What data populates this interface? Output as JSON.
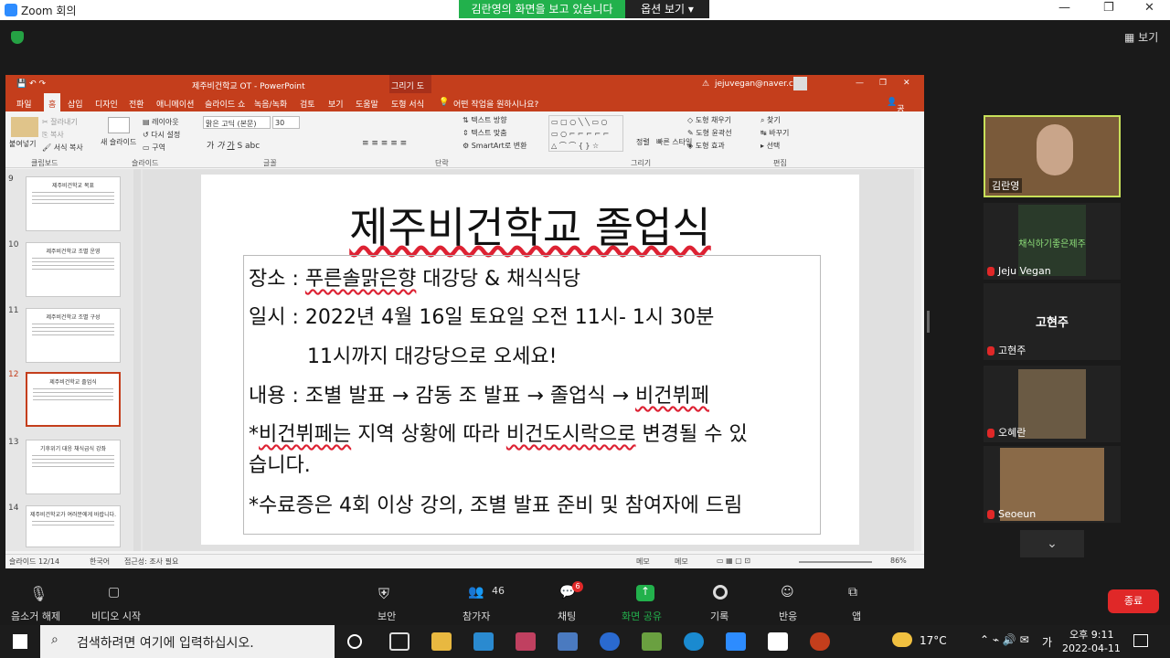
{
  "zoom": {
    "title": "Zoom 회의",
    "banner": "김란영의 화면을 보고 있습니다",
    "view_options": "옵션 보기",
    "view": "보기"
  },
  "ppt": {
    "title": "제주비건학교 OT - PowerPoint",
    "drawing_tools": "그리기 도구",
    "account": "jejuvegan@naver.com",
    "tabs": [
      "파일",
      "홈",
      "삽입",
      "디자인",
      "전환",
      "애니메이션",
      "슬라이드 쇼",
      "녹음/녹화",
      "검토",
      "보기",
      "도움말",
      "도형 서식"
    ],
    "tell_me": "어떤 작업을 원하시나요?",
    "share": "공유",
    "ribbon": {
      "paste": "붙여넣기",
      "cut": "잘라내기",
      "copy": "복사",
      "format_painter": "서식 복사",
      "new_slide": "새 슬라이드",
      "layout": "레이아웃",
      "reset": "다시 설정",
      "section": "구역",
      "font": "맑은 고딕 (본문)",
      "size": "30",
      "text_direction": "텍스트 방향",
      "align_text": "텍스트 맞춤",
      "smartart": "SmartArt로 변환",
      "arrange": "정렬",
      "quick_styles": "빠른 스타일",
      "shape_fill": "도형 채우기",
      "shape_outline": "도형 윤곽선",
      "shape_effects": "도형 효과",
      "find": "찾기",
      "replace": "바꾸기",
      "select": "선택",
      "groups": [
        "클립보드",
        "슬라이드",
        "글꼴",
        "단락",
        "그리기",
        "편집"
      ]
    },
    "thumbs": [
      {
        "num": "9",
        "title": "제주비건학교 목표"
      },
      {
        "num": "10",
        "title": "제주비건학교 조별 운영"
      },
      {
        "num": "11",
        "title": "제주비건학교 조별 구성"
      },
      {
        "num": "12",
        "title": "제주비건학교 졸업식"
      },
      {
        "num": "13",
        "title": "기후위기 대응 채식급식 강좌"
      },
      {
        "num": "14",
        "title": "제주비건학교가 여러분에게 바랍니다."
      }
    ],
    "slide": {
      "title": "제주비건학교 졸업식",
      "line1a": "장소 : ",
      "line1b": "푸른솔맑은향",
      "line1c": " 대강당 & 채식식당",
      "line2": "일시 : 2022년 4월 16일 토요일 오전 11시- 1시 30분",
      "line3": "11시까지 대강당으로 오세요!",
      "line4a": "내용 : 조별 발표 → 감동 조 발표 → 졸업식 → ",
      "line4b": "비건뷔페",
      "line5a": "*",
      "line5b": "비건뷔페는",
      "line5c": " 지역 상황에 따라 ",
      "line5d": "비건도시락으로",
      "line5e": " 변경될 수 있",
      "line6": "습니다.",
      "line7": "*수료증은 4회 이상 강의, 조별 발표 준비 및 참여자에 드림"
    },
    "status": {
      "slide": "슬라이드 12/14",
      "lang": "한국어",
      "accessibility": "접근성: 조사 필요",
      "notes": "메모",
      "comments": "메모",
      "zoom": "86%"
    }
  },
  "participants": [
    {
      "name": "김란영"
    },
    {
      "name": "Jeju Vegan"
    },
    {
      "name": "고현주",
      "big": "고현주"
    },
    {
      "name": "오혜란"
    },
    {
      "name": "Seoeun"
    }
  ],
  "vegan_poster": "채식하기좋은제주",
  "toolbar": {
    "mute": "음소거 해제",
    "video": "비디오 시작",
    "security": "보안",
    "participants": "참가자",
    "participants_count": "46",
    "chat": "채팅",
    "chat_badge": "6",
    "share": "화면 공유",
    "record": "기록",
    "reactions": "반응",
    "apps": "앱",
    "end": "종료"
  },
  "taskbar": {
    "search": "검색하려면 여기에 입력하십시오.",
    "temp": "17°C",
    "ime": "가",
    "time": "오후 9:11",
    "date": "2022-04-11"
  }
}
